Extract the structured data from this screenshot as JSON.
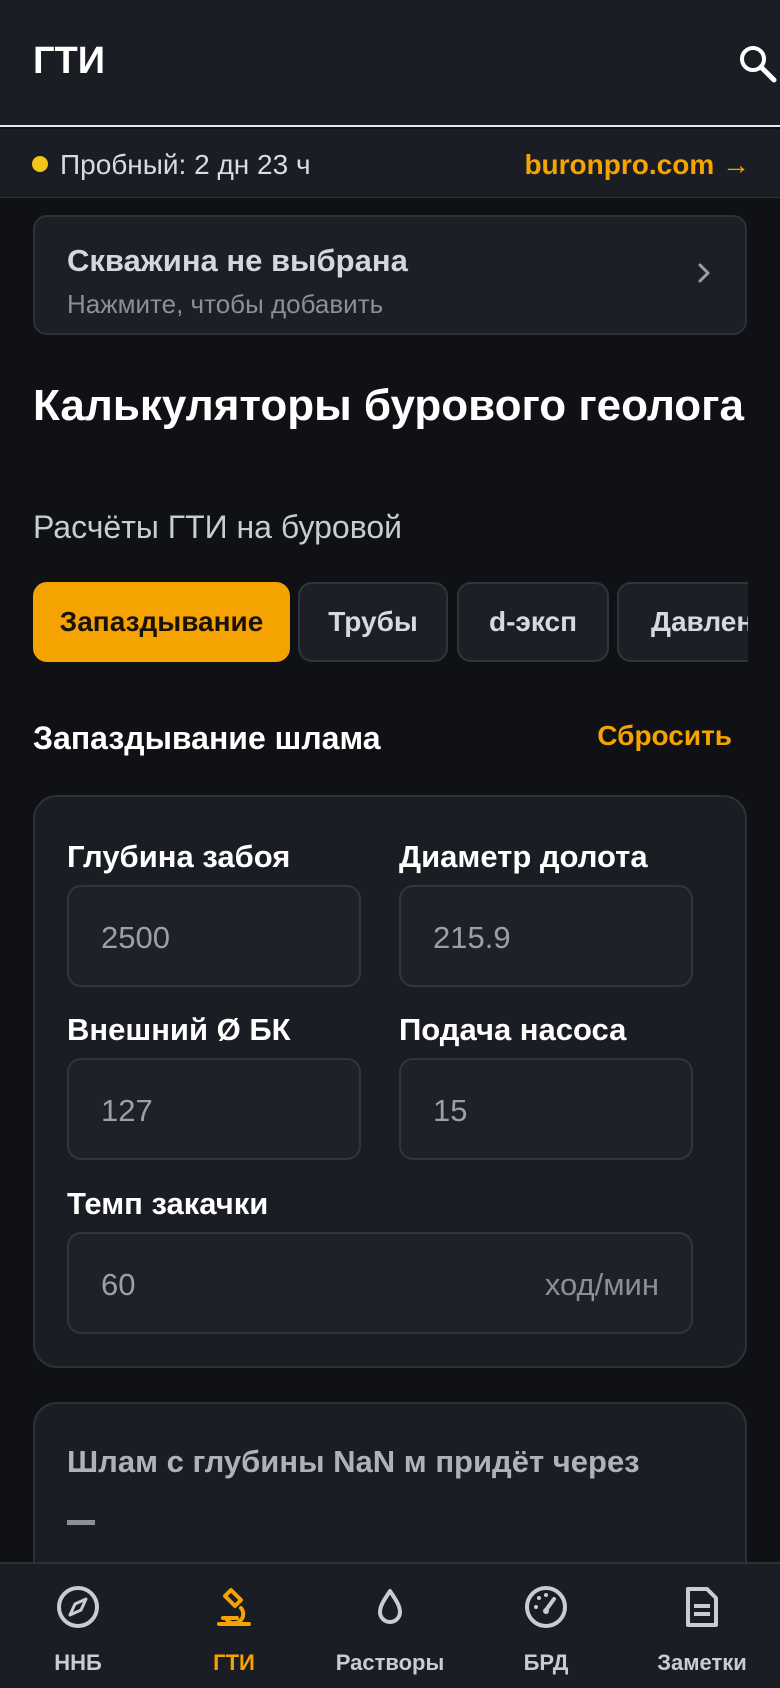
{
  "header": {
    "title": "ГТИ"
  },
  "trial": {
    "text": "Пробный: 2 дн 23 ч",
    "link": "buronpro.com →"
  },
  "well": {
    "title": "Скважина не выбрана",
    "subtitle": "Нажмите, чтобы добавить"
  },
  "page": {
    "title": "Калькуляторы бурового геолога",
    "subtitle": "Расчёты ГТИ на буровой"
  },
  "tabs": [
    {
      "label": "Запаздывание",
      "active": true
    },
    {
      "label": "Трубы",
      "active": false
    },
    {
      "label": "d-эксп",
      "active": false
    },
    {
      "label": "Давление",
      "active": false
    }
  ],
  "section": {
    "title": "Запаздывание шлама",
    "reset": "Сбросить"
  },
  "form": {
    "depth": {
      "label": "Глубина забоя",
      "placeholder": "2500"
    },
    "bit": {
      "label": "Диаметр долота",
      "placeholder": "215.9"
    },
    "od": {
      "label": "Внешний Ø БК",
      "placeholder": "127"
    },
    "pump": {
      "label": "Подача насоса",
      "placeholder": "15"
    },
    "rate": {
      "label": "Темп закачки",
      "placeholder": "60",
      "unit": "ход/мин"
    }
  },
  "result": {
    "text": "Шлам с глубины NaN м придёт через",
    "value": "—"
  },
  "nav": [
    {
      "label": "ННБ",
      "icon": "compass-icon",
      "active": false
    },
    {
      "label": "ГТИ",
      "icon": "microscope-icon",
      "active": true
    },
    {
      "label": "Растворы",
      "icon": "drop-icon",
      "active": false
    },
    {
      "label": "БРД",
      "icon": "gauge-icon",
      "active": false
    },
    {
      "label": "Заметки",
      "icon": "note-icon",
      "active": false
    }
  ],
  "colors": {
    "accent": "#f5a300",
    "background": "#0f1115",
    "card": "#1a1d23",
    "trial_dot": "#f5c518"
  }
}
